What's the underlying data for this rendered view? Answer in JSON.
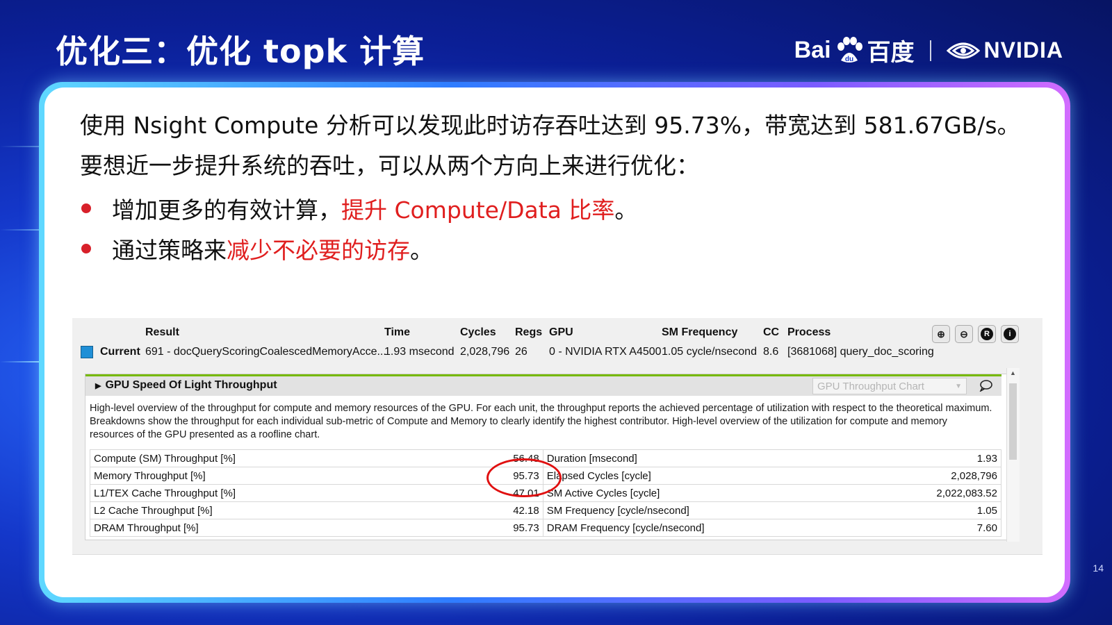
{
  "slide": {
    "title": "优化三：优化 topk 计算",
    "logos": {
      "baidu_left": "Bai",
      "baidu_right": "百度",
      "nvidia": "NVIDIA"
    },
    "paragraph": "使用 Nsight Compute 分析可以发现此时访存吞吐达到 95.73%，带宽达到 581.67GB/s。要想近一步提升系统的吞吐，可以从两个方向上来进行优化：",
    "bullets": [
      {
        "normal": "增加更多的有效计算，",
        "highlight": "提升 Compute/Data 比率",
        "end": "。"
      },
      {
        "normal": "通过策略来",
        "highlight": "减少不必要的访存",
        "end": "。"
      }
    ],
    "page_number": "14",
    "accent_color": "#e01e1e"
  },
  "nsight": {
    "headers": {
      "result": "Result",
      "time": "Time",
      "cycles": "Cycles",
      "regs": "Regs",
      "gpu": "GPU",
      "sm_freq": "SM Frequency",
      "cc": "CC",
      "process": "Process"
    },
    "current": {
      "label": "Current",
      "result": "691 - docQueryScoringCoalescedMemoryAcce...",
      "time": "1.93 msecond",
      "cycles": "2,028,796",
      "regs": "26",
      "gpu": "0 - NVIDIA RTX A4500",
      "sm_freq": "1.05 cycle/nsecond",
      "cc": "8.6",
      "process": "[3681068] query_doc_scoring"
    },
    "toolbar_icons": [
      "add-icon",
      "remove-icon",
      "record-icon",
      "info-icon"
    ],
    "section": {
      "title": "GPU Speed Of Light Throughput",
      "select_placeholder": "GPU Throughput Chart",
      "description": "High-level overview of the throughput for compute and memory resources of the GPU. For each unit, the throughput reports the achieved percentage of utilization with respect to the theoretical maximum. Breakdowns show the throughput for each individual sub-metric of Compute and Memory to clearly identify the highest contributor. High-level overview of the utilization for compute and memory resources of the GPU presented as a roofline chart.",
      "rows": [
        {
          "left_label": "Compute (SM) Throughput [%]",
          "left_value": "56.48",
          "right_label": "Duration [msecond]",
          "right_value": "1.93"
        },
        {
          "left_label": "Memory Throughput [%]",
          "left_value": "95.73",
          "right_label": "Elapsed Cycles [cycle]",
          "right_value": "2,028,796"
        },
        {
          "left_label": "L1/TEX Cache Throughput [%]",
          "left_value": "47.01",
          "right_label": "SM Active Cycles [cycle]",
          "right_value": "2,022,083.52"
        },
        {
          "left_label": "L2 Cache Throughput [%]",
          "left_value": "42.18",
          "right_label": "SM Frequency [cycle/nsecond]",
          "right_value": "1.05"
        },
        {
          "left_label": "DRAM Throughput [%]",
          "left_value": "95.73",
          "right_label": "DRAM Frequency [cycle/nsecond]",
          "right_value": "7.60"
        }
      ]
    }
  }
}
